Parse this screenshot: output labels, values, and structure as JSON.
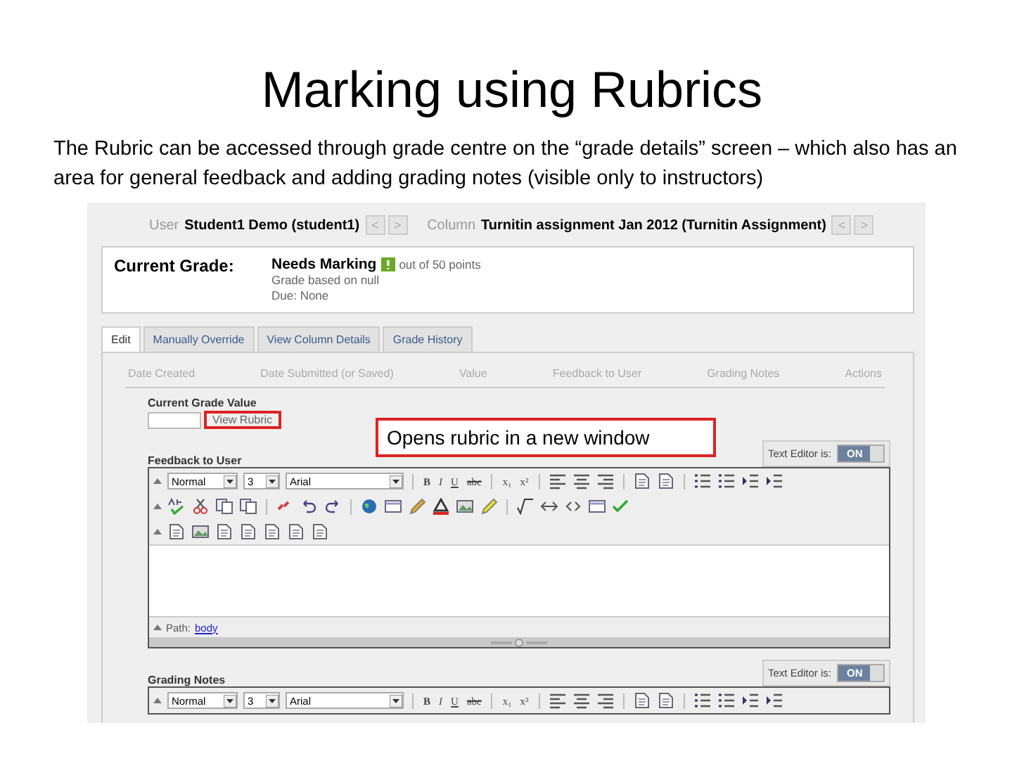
{
  "slide": {
    "title": "Marking using Rubrics",
    "subtitle": "The Rubric can be accessed through grade centre on the “grade details” screen – which also has an area for general feedback and adding grading notes (visible only to instructors)"
  },
  "header": {
    "user_label": "User",
    "user": "Student1 Demo (student1)",
    "column_label": "Column",
    "column": "Turnitin assignment Jan 2012 (Turnitin Assignment)",
    "prev": "<",
    "next": ">"
  },
  "current_grade": {
    "label": "Current Grade:",
    "status": "Needs Marking",
    "out_of": "out of 50 points",
    "based_on": "Grade based on null",
    "due": "Due: None"
  },
  "tabs": [
    {
      "label": "Edit",
      "selected": true
    },
    {
      "label": "Manually Override",
      "selected": false
    },
    {
      "label": "View Column Details",
      "selected": false
    },
    {
      "label": "Grade History",
      "selected": false
    }
  ],
  "columns": [
    "Date Created",
    "Date Submitted (or Saved)",
    "Value",
    "Feedback to User",
    "Grading Notes",
    "Actions"
  ],
  "grade_value": {
    "label": "Current Grade Value",
    "rubric_link": "View Rubric"
  },
  "callout": "Opens rubric in a new window",
  "editors": [
    {
      "label": "Feedback to User",
      "toggle_label": "Text Editor is:",
      "toggle": "ON",
      "on": true,
      "style": "Normal",
      "size": "3",
      "font": "Arial",
      "format_buttons": [
        "B",
        "I",
        "U",
        "abc",
        "x₁",
        "x²"
      ],
      "path_label": "Path:",
      "path": "body"
    },
    {
      "label": "Grading Notes",
      "toggle_label": "Text Editor is:",
      "toggle": "ON",
      "on": true,
      "style": "Normal",
      "size": "3",
      "font": "Arial",
      "format_buttons": [
        "B",
        "I",
        "U",
        "abc",
        "x₁",
        "x²"
      ]
    }
  ]
}
